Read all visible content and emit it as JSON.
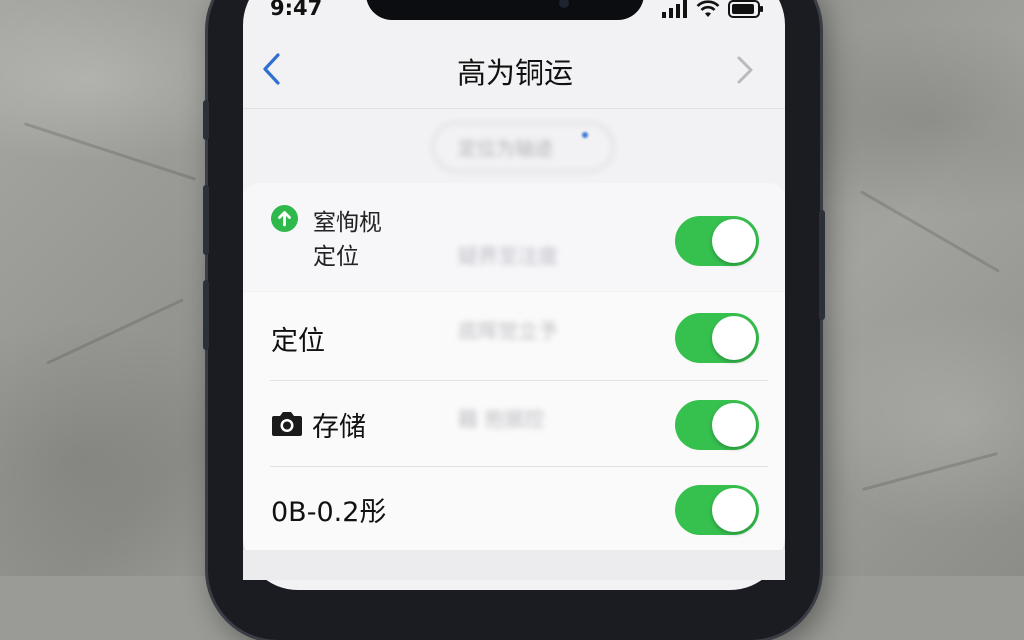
{
  "status_bar": {
    "time": "9:47",
    "icons": [
      "signal-icon",
      "wifi-icon",
      "battery-icon"
    ]
  },
  "nav": {
    "title": "高为铜运",
    "back_icon": "chevron-left-icon",
    "forward_icon": "chevron-right-icon"
  },
  "background_ghost": {
    "pill_text": "定位为轴迹",
    "line1": "疑界至注度",
    "line2": "底晖觉立予",
    "line3": "籍 抱据控"
  },
  "settings": {
    "top_row": {
      "icon": "arrow-up-circle-icon",
      "label_line1": "窒恂枧",
      "label_line2": "定位",
      "enabled": true
    },
    "rows": [
      {
        "label": "定位",
        "icon": null,
        "enabled": true
      },
      {
        "label": "存储",
        "icon": "camera-icon",
        "enabled": true
      },
      {
        "label": "0B-0.2彤",
        "icon": null,
        "enabled": true
      }
    ]
  },
  "colors": {
    "toggle_on": "#36c04e",
    "accent_blue": "#3d7bd6"
  }
}
